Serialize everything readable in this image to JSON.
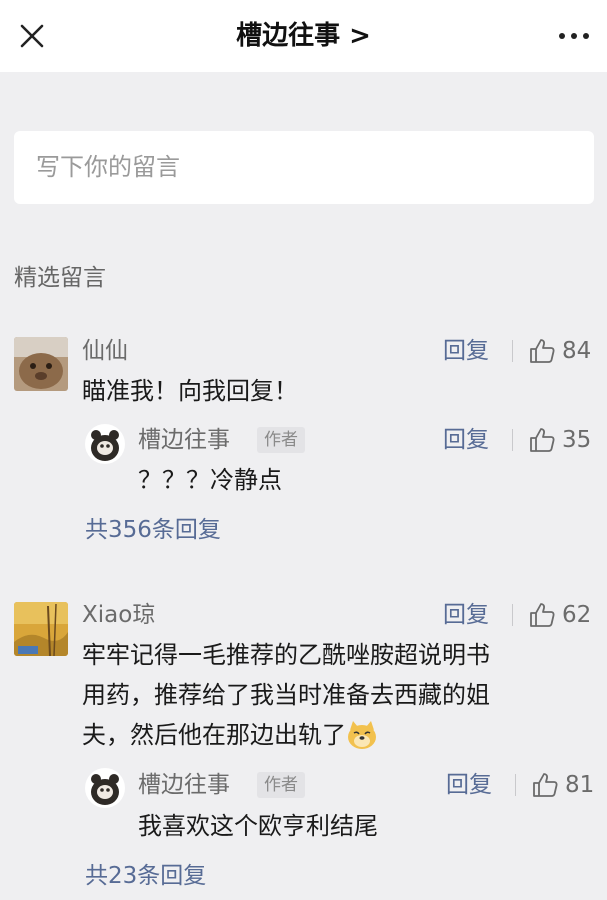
{
  "header": {
    "title": "槽边往事 >"
  },
  "comment_input": {
    "placeholder": "写下你的留言"
  },
  "section_title": "精选留言",
  "comments": [
    {
      "name": "仙仙",
      "reply_label": "回复",
      "likes": "84",
      "text": "瞄准我！向我回复！",
      "author_reply": {
        "name": "槽边往事",
        "badge": "作者",
        "reply_label": "回复",
        "likes": "35",
        "text": "？？？冷静点"
      },
      "reply_count": "共356条回复"
    },
    {
      "name": "Xiao琼",
      "reply_label": "回复",
      "likes": "62",
      "text_lines": [
        "牢牢记得一毛推荐的乙酰唑胺超说明书",
        "用药，推荐给了我当时准备去西藏的姐",
        "夫，然后他在那边出轨了"
      ],
      "author_reply": {
        "name": "槽边往事",
        "badge": "作者",
        "reply_label": "回复",
        "likes": "81",
        "text": "我喜欢这个欧亨利结尾"
      },
      "reply_count": "共23条回复"
    }
  ],
  "colors": {
    "link": "#576b95",
    "background": "#efeff1"
  }
}
